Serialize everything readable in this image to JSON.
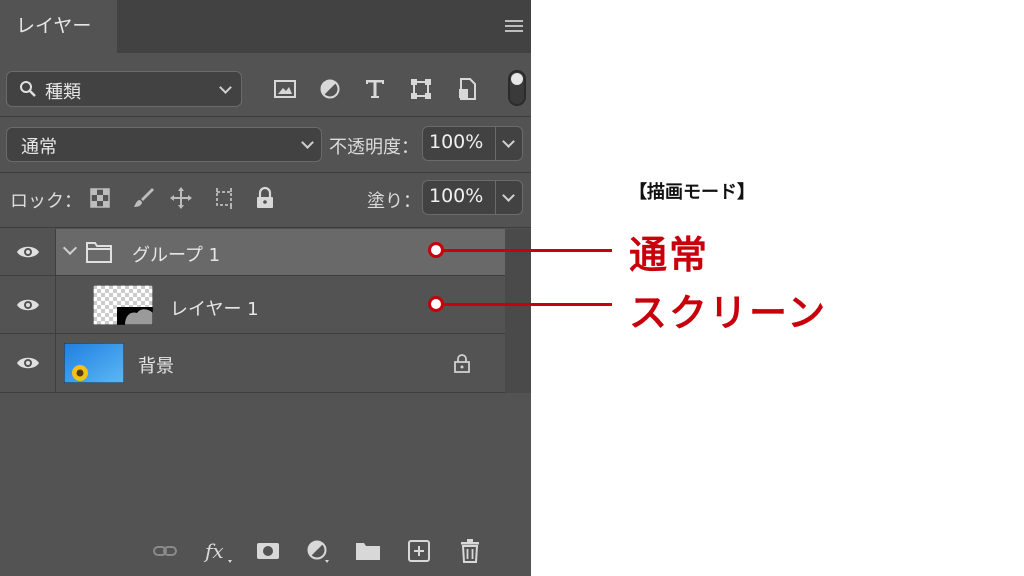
{
  "panel": {
    "tab_label": "レイヤー",
    "filter": {
      "value": "種類"
    },
    "blend_mode": {
      "value": "通常"
    },
    "opacity": {
      "label": "不透明度：",
      "value": "100%"
    },
    "lock": {
      "label": "ロック："
    },
    "fill": {
      "label": "塗り：",
      "value": "100%"
    }
  },
  "layers": [
    {
      "name": "グループ 1",
      "type": "group",
      "expanded": true,
      "selected": true
    },
    {
      "name": "レイヤー 1",
      "type": "layer"
    },
    {
      "name": "背景",
      "type": "background",
      "locked": true
    }
  ],
  "annotation": {
    "title": "【描画モード】",
    "group_mode": "通常",
    "layer_mode": "スクリーン",
    "color": "#c7000b"
  },
  "colors": {
    "panel_bg": "#535353",
    "dark_bg": "#424242",
    "selected_row": "#696969"
  }
}
